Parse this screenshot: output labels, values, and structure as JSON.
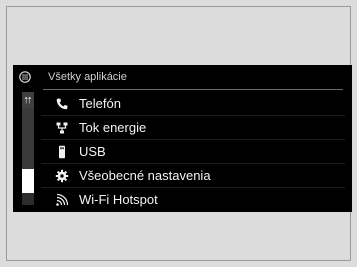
{
  "header": {
    "icon": "apps-grid-icon",
    "title": "Všetky aplikácie"
  },
  "scrollbar": {
    "up_glyph": "⮅"
  },
  "menu": {
    "items": [
      {
        "label": "Telefón",
        "icon": "phone-icon"
      },
      {
        "label": "Tok energie",
        "icon": "energy-flow-icon"
      },
      {
        "label": "USB",
        "icon": "usb-icon"
      },
      {
        "label": "Všeobecné nastavenia",
        "icon": "gear-icon"
      },
      {
        "label": "Wi-Fi Hotspot",
        "icon": "wifi-hotspot-icon"
      }
    ]
  },
  "colors": {
    "screen_bg": "#000000",
    "text": "#f2f2f2",
    "page_bg": "#dcdcdc"
  }
}
